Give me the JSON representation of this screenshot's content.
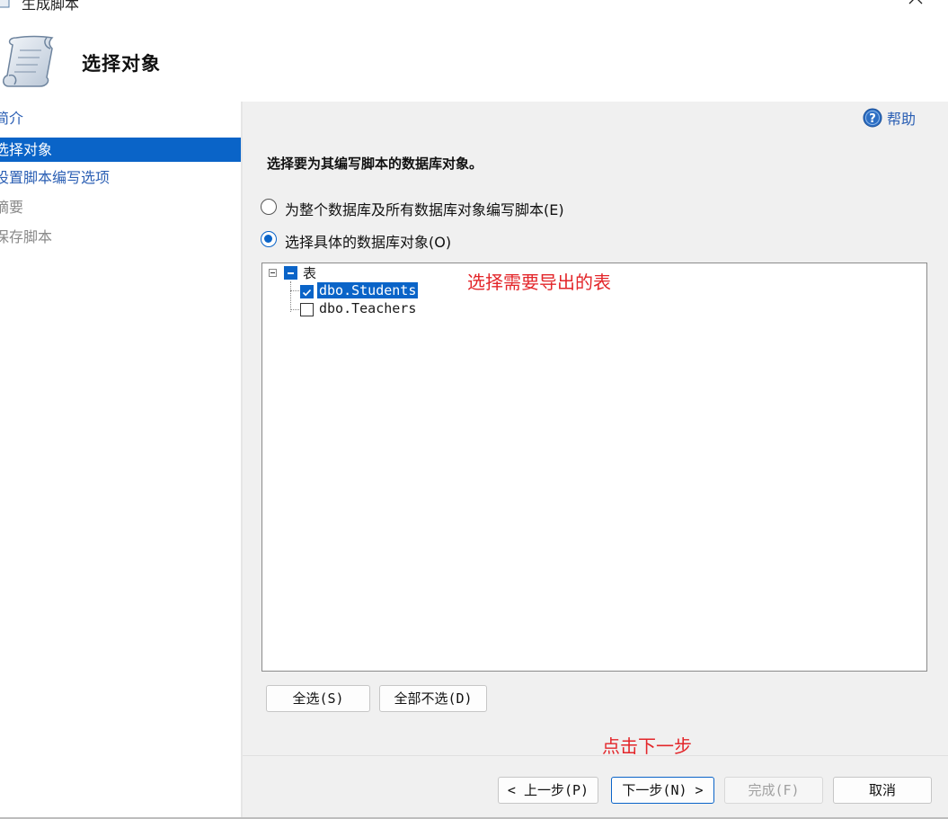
{
  "window": {
    "title": "生成脚本",
    "minimize_icon": "minimize-icon",
    "maximize_icon": "maximize-icon",
    "close_icon": "close-icon"
  },
  "header": {
    "title": "选择对象",
    "icon": "script-scroll-icon"
  },
  "sidebar": {
    "items": [
      {
        "label": "简介",
        "state": "link"
      },
      {
        "label": "选择对象",
        "state": "active"
      },
      {
        "label": "设置脚本编写选项",
        "state": "link"
      },
      {
        "label": "摘要",
        "state": "disabled"
      },
      {
        "label": "保存脚本",
        "state": "disabled"
      }
    ]
  },
  "main": {
    "help_label": "帮助",
    "prompt": "选择要为其编写脚本的数据库对象。",
    "options": [
      {
        "label": "为整个数据库及所有数据库对象编写脚本(E)",
        "checked": false
      },
      {
        "label": "选择具体的数据库对象(O)",
        "checked": true
      }
    ],
    "tree": {
      "root": {
        "label": "表",
        "state": "partial",
        "expanded": true
      },
      "children": [
        {
          "label": "dbo.Students",
          "checked": true,
          "selected": true
        },
        {
          "label": "dbo.Teachers",
          "checked": false,
          "selected": false
        }
      ]
    },
    "select_all_label": "全选(S)",
    "deselect_all_label": "全部不选(D)"
  },
  "annotations": {
    "tree_note": "选择需要导出的表",
    "next_note": "点击下一步"
  },
  "footer": {
    "prev_label": "< 上一步(P)",
    "next_label": "下一步(N) >",
    "finish_label": "完成(F)",
    "cancel_label": "取消"
  },
  "colors": {
    "accent": "#0a64c8",
    "link": "#2b5fb4",
    "annotation": "#e3262a",
    "panel": "#f0f0f0"
  }
}
